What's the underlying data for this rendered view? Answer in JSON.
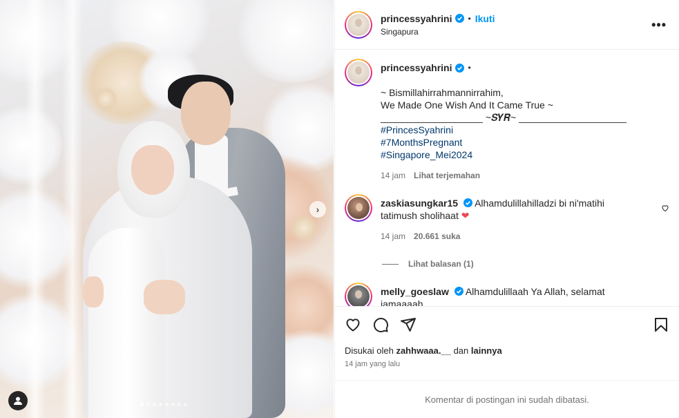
{
  "post": {
    "username": "princessyahrini",
    "follow_label": "Ikuti",
    "separator": "•",
    "location": "Singapura",
    "more_icon": "more-horizontal-icon",
    "image_dots_total": 8,
    "image_dot_active": 1
  },
  "caption": {
    "username": "princessyahrini",
    "separator": "•",
    "lines": [
      "~ Bismillahirrahmannirrahim,",
      "We Made One Wish And It Came True ~",
      "",
      "___________________ ~𝑺𝒀𝑹~ ____________________",
      ""
    ],
    "hashtags": [
      "#PrincesSyahrini",
      "#7MonthsPregnant",
      "#Singapore_Mei2024"
    ],
    "time": "14 jam",
    "translate_label": "Lihat terjemahan"
  },
  "comments": [
    {
      "username": "zaskiasungkar15",
      "text": "Alhamdulillahilladzi bi ni'matihi tatimush sholihaat",
      "emoji": "❤",
      "time": "14 jam",
      "likes": "20.661 suka",
      "replies_label": "Lihat balasan (1)"
    },
    {
      "username": "melly_goeslaw",
      "text": "Alhamdulillaah Ya Allah, selamat jamaaaah"
    }
  ],
  "actions": {
    "like_icon": "heart-icon",
    "comment_icon": "comment-icon",
    "share_icon": "share-icon",
    "save_icon": "bookmark-icon"
  },
  "likes": {
    "prefix": "Disukai oleh",
    "user": "zahhwaaa.__",
    "conj": "dan",
    "others": "lainnya"
  },
  "timestamp": "14 jam yang lalu",
  "comments_restricted": "Komentar di postingan ini sudah dibatasi.",
  "colors": {
    "link_blue": "#0095f6",
    "hashtag_blue": "#00376b",
    "verified_blue": "#0095f6",
    "muted": "#737373",
    "red_heart": "#ed4956"
  }
}
